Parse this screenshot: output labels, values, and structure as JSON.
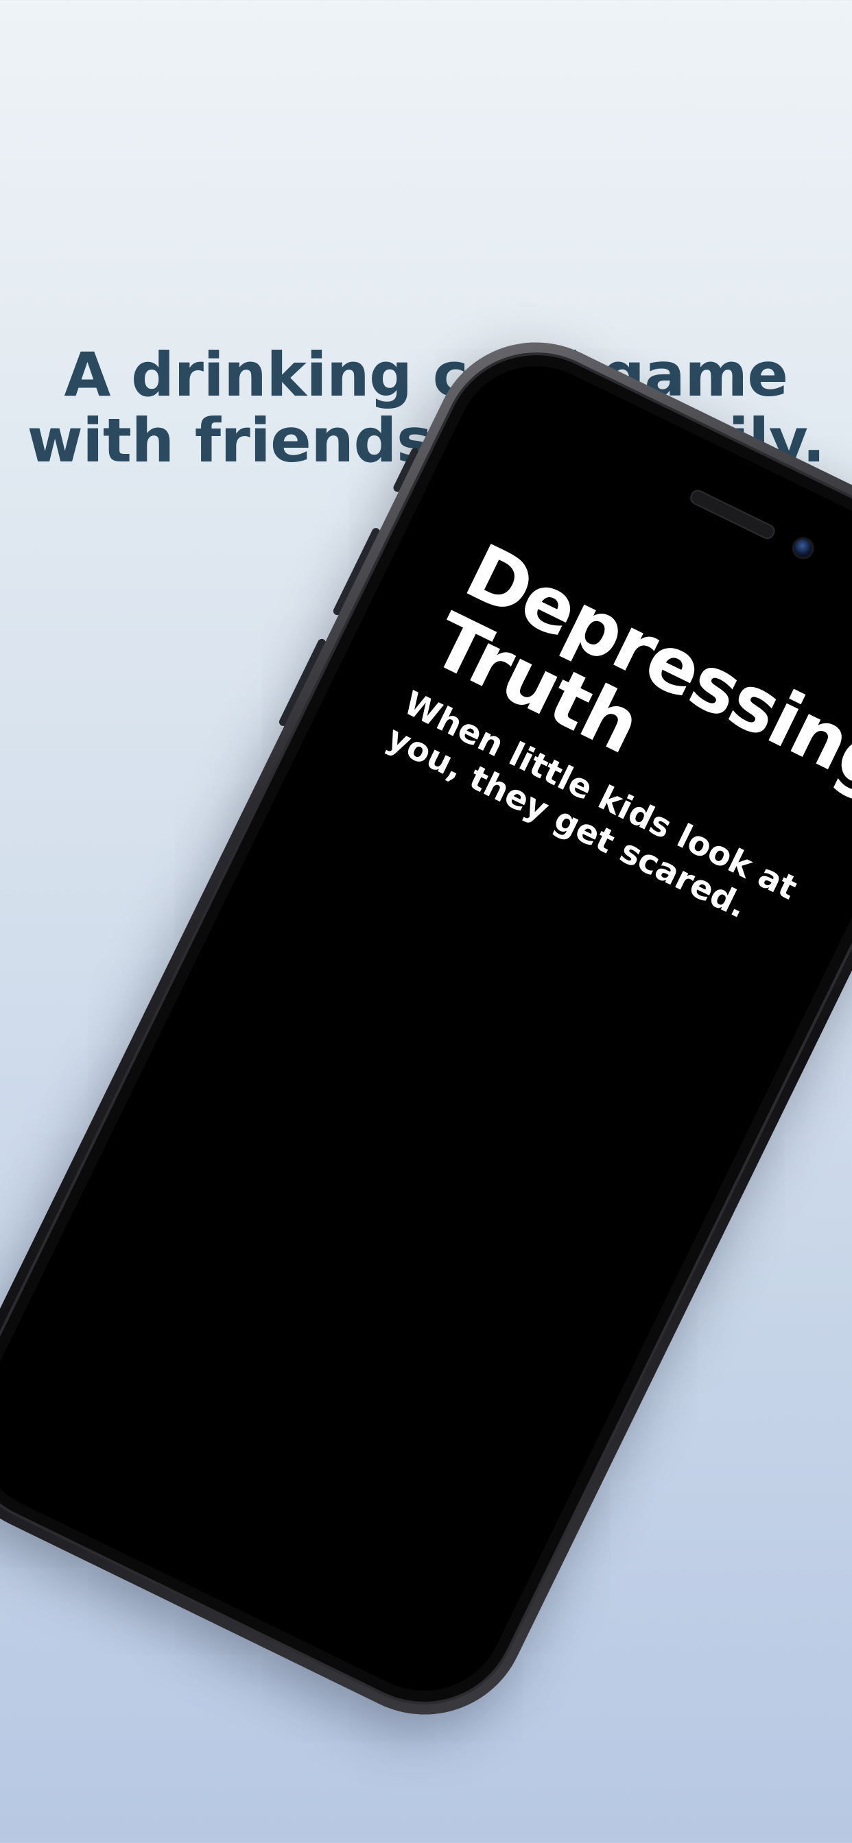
{
  "headline": {
    "line1": "A drinking card game",
    "line2": "with friends and family."
  },
  "card": {
    "title_line1": "Depressing",
    "title_line2": "Truth",
    "text": "When little kids look at you, they get scared."
  },
  "colors": {
    "headline": "#2b4a5f",
    "background_top": "#eef3f6",
    "background_bottom": "#b7c8e3",
    "screen": "#000000",
    "card_text": "#ffffff"
  }
}
